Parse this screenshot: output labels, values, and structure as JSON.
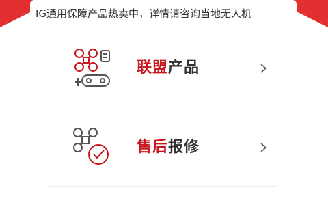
{
  "notice": {
    "text": "IG通用保障产品热卖中，详情请咨询当地无人机"
  },
  "menu": [
    {
      "accent": "联盟",
      "rest": "产品",
      "icon": "drone-controller-icon"
    },
    {
      "accent": "售后",
      "rest": "报修",
      "icon": "drone-check-icon"
    }
  ],
  "colors": {
    "accent": "#c8161d",
    "background_red": "#e23030",
    "text": "#333333"
  }
}
